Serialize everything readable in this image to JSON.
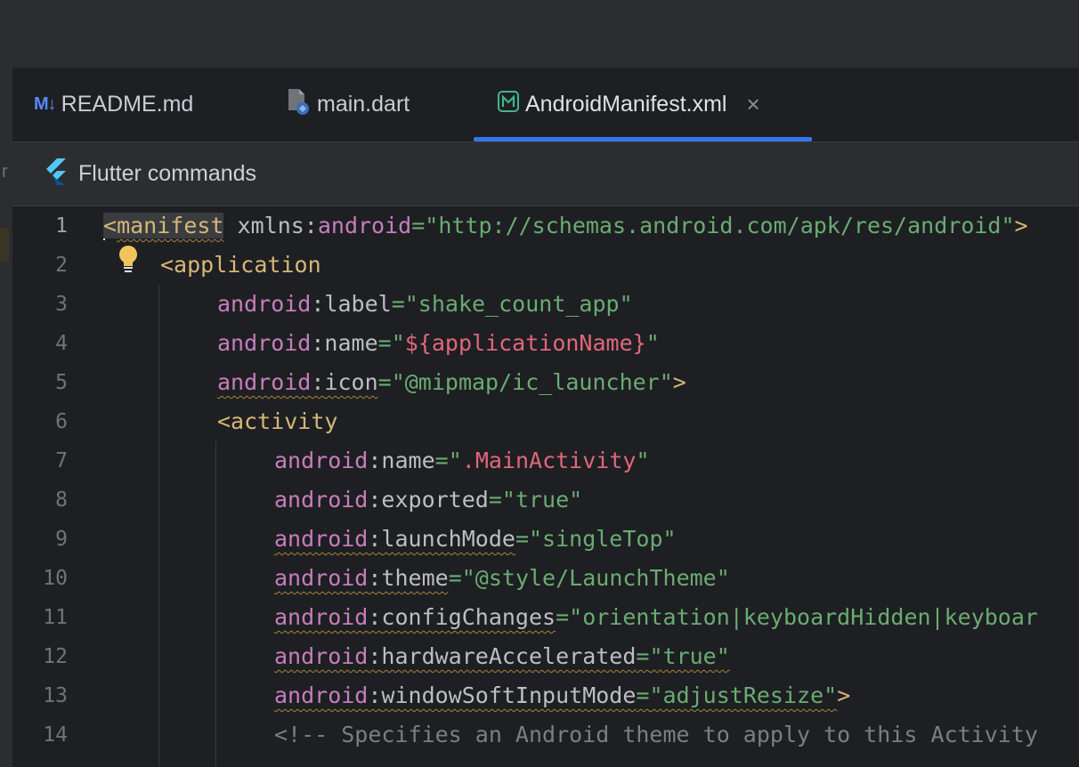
{
  "tabs": [
    {
      "icon": "markdown-icon",
      "icon_text": "M↓",
      "label": "README.md",
      "active": false
    },
    {
      "icon": "dart-file-icon",
      "label": "main.dart",
      "active": false
    },
    {
      "icon": "manifest-xml-icon",
      "label": "AndroidManifest.xml",
      "active": true,
      "close": "×"
    }
  ],
  "toolbar": {
    "label": "Flutter commands"
  },
  "left_strip_char": "r",
  "colors": {
    "accent": "#3574f0",
    "tag": "#d5b778",
    "namespace": "#c77dbb",
    "value": "#6aab73",
    "comment": "#7a7e85"
  },
  "editor": {
    "line_numbers": [
      "1",
      "2",
      "3",
      "4",
      "5",
      "6",
      "7",
      "8",
      "9",
      "10",
      "11",
      "12",
      "13",
      "14"
    ],
    "lines": {
      "l1": {
        "lt": "<",
        "tag": "manifest",
        "attr": " xmlns:",
        "ns": "android",
        "eq": "=",
        "val": "\"http://schemas.android.com/apk/res/android\"",
        "end": ">"
      },
      "l2": {
        "tag": "<application"
      },
      "l3": {
        "ns": "android",
        "colon": ":",
        "attr": "label",
        "eq": "=",
        "val": "\"shake_count_app\""
      },
      "l4": {
        "ns": "android",
        "colon": ":",
        "attr": "name",
        "eq": "=",
        "q1": "\"",
        "ent": "${applicationName}",
        "q2": "\""
      },
      "l5": {
        "ns": "android",
        "colon": ":",
        "attr": "icon",
        "eq": "=",
        "val": "\"@mipmap/ic_launcher\"",
        "end": ">"
      },
      "l6": {
        "tag": "<activity"
      },
      "l7": {
        "ns": "android",
        "colon": ":",
        "attr": "name",
        "eq": "=",
        "q1": "\"",
        "ent": ".MainActivity",
        "q2": "\""
      },
      "l8": {
        "ns": "android",
        "colon": ":",
        "attr": "exported",
        "eq": "=",
        "val": "\"true\""
      },
      "l9": {
        "ns": "android",
        "colon": ":",
        "attr": "launchMode",
        "eq": "=",
        "val": "\"singleTop\""
      },
      "l10": {
        "ns": "android",
        "colon": ":",
        "attr": "theme",
        "eq": "=",
        "val": "\"@style/LaunchTheme\""
      },
      "l11": {
        "ns": "android",
        "colon": ":",
        "attr": "configChanges",
        "eq": "=",
        "val": "\"orientation|keyboardHidden|keyboar"
      },
      "l12": {
        "ns": "android",
        "colon": ":",
        "attr": "hardwareAccelerated",
        "eq": "=",
        "val": "\"true\""
      },
      "l13": {
        "ns": "android",
        "colon": ":",
        "attr": "windowSoftInputMode",
        "eq": "=",
        "val": "\"adjustResize\"",
        "end": ">"
      },
      "l14": {
        "cmt": "<!-- Specifies an Android theme to apply to this Activity"
      }
    }
  }
}
